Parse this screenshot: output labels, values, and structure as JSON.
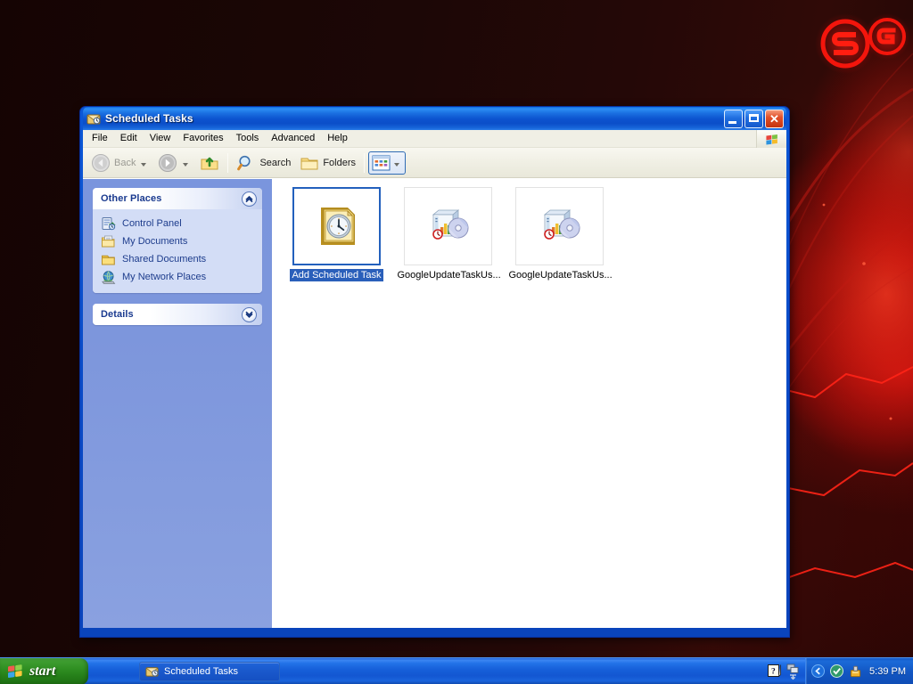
{
  "desktop": {
    "wallpaper_colors": {
      "base": "#1a0605",
      "accent_red": "#ff1914",
      "deep_red": "#8c0806"
    },
    "logos": [
      {
        "name": "logo-mark-s",
        "label": "S"
      },
      {
        "name": "logo-mark-g",
        "label": "G"
      }
    ]
  },
  "window": {
    "title": "Scheduled Tasks",
    "title_icon": "scheduled-tasks-icon",
    "controls": {
      "minimize": "Minimize",
      "maximize": "Maximize",
      "close": "Close"
    },
    "menu": [
      {
        "label": "File"
      },
      {
        "label": "Edit"
      },
      {
        "label": "View"
      },
      {
        "label": "Favorites"
      },
      {
        "label": "Tools"
      },
      {
        "label": "Advanced"
      },
      {
        "label": "Help"
      }
    ],
    "menu_brand_icon": "windows-flag-icon",
    "toolbar": {
      "back": {
        "label": "Back",
        "icon": "arrow-left-icon",
        "disabled": true
      },
      "forward": {
        "label": "",
        "icon": "arrow-right-icon",
        "disabled": false
      },
      "up": {
        "label": "",
        "icon": "folder-up-icon"
      },
      "search": {
        "label": "Search",
        "icon": "magnifier-icon"
      },
      "folders": {
        "label": "Folders",
        "icon": "folder-icon"
      },
      "views": {
        "label": "",
        "icon": "views-grid-icon"
      }
    }
  },
  "sidebar": {
    "panels": [
      {
        "title": "Other Places",
        "chevron": "chevron-up-icon",
        "collapsed": false,
        "items": [
          {
            "label": "Control Panel",
            "icon": "control-panel-icon"
          },
          {
            "label": "My Documents",
            "icon": "my-documents-icon"
          },
          {
            "label": "Shared Documents",
            "icon": "shared-documents-icon"
          },
          {
            "label": "My Network Places",
            "icon": "network-places-icon"
          }
        ]
      },
      {
        "title": "Details",
        "chevron": "chevron-down-icon",
        "collapsed": true,
        "items": []
      }
    ]
  },
  "files": {
    "view_mode": "Tiles",
    "items": [
      {
        "name": "Add Scheduled Task",
        "icon": "add-scheduled-task-icon",
        "selected": true
      },
      {
        "name": "GoogleUpdateTaskUs...",
        "icon": "google-update-task-icon",
        "selected": false
      },
      {
        "name": "GoogleUpdateTaskUs...",
        "icon": "google-update-task-icon",
        "selected": false
      }
    ]
  },
  "taskbar": {
    "start_label": "start",
    "start_icon": "windows-flag-icon",
    "tasks": [
      {
        "label": "Scheduled Tasks",
        "icon": "scheduled-tasks-icon",
        "active": true
      }
    ],
    "tray": {
      "icons": [
        {
          "name": "help-question-icon"
        },
        {
          "name": "network-connection-icon"
        },
        {
          "name": "show-hidden-icons-chevron"
        },
        {
          "name": "shield-green-icon"
        },
        {
          "name": "safely-remove-hardware-icon"
        }
      ],
      "clock": "5:39 PM"
    }
  }
}
